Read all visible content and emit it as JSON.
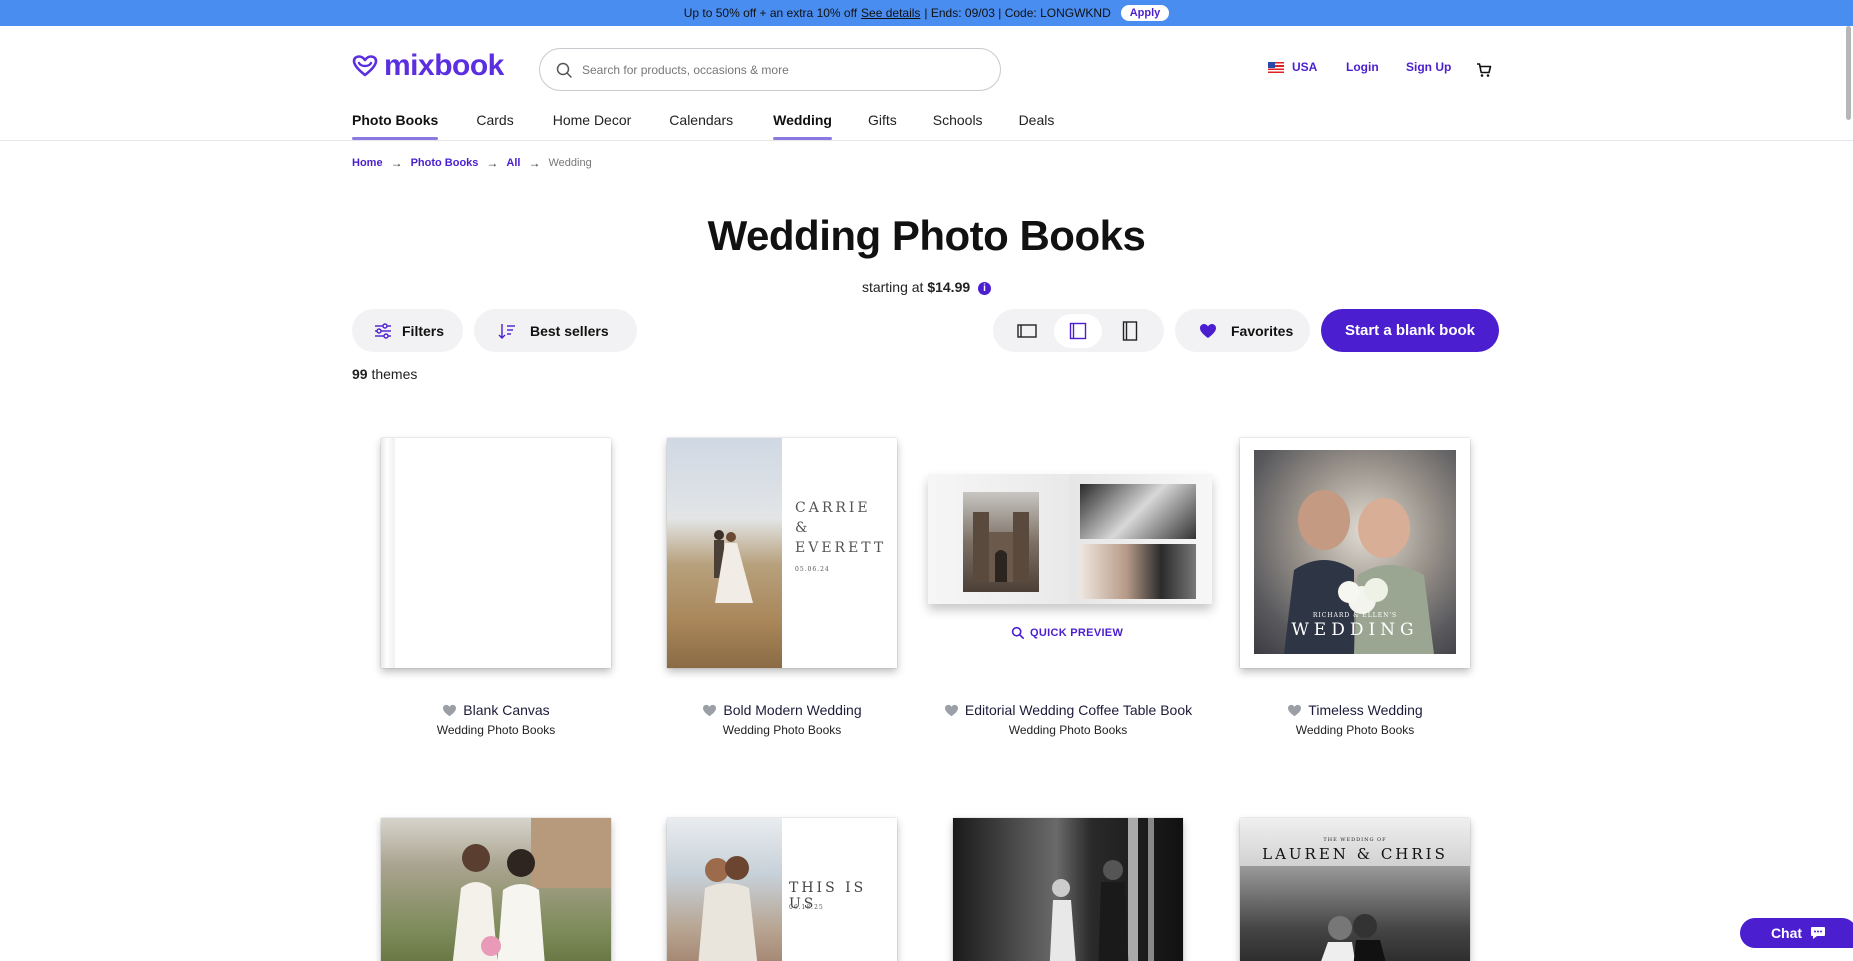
{
  "promo": {
    "text": "Up to 50% off + an extra 10% off",
    "link": "See details",
    "rest": "| Ends: 09/03 | Code: LONGWKND",
    "apply": "Apply"
  },
  "header": {
    "logo": "mixbook",
    "search_placeholder": "Search for products, occasions & more",
    "country": "USA",
    "login": "Login",
    "signup": "Sign Up"
  },
  "nav": [
    {
      "label": "Photo Books",
      "active": true
    },
    {
      "label": "Cards",
      "active": false
    },
    {
      "label": "Home Decor",
      "active": false
    },
    {
      "label": "Calendars",
      "active": false
    },
    {
      "label": "Wedding",
      "active": true
    },
    {
      "label": "Gifts",
      "active": false
    },
    {
      "label": "Schools",
      "active": false
    },
    {
      "label": "Deals",
      "active": false
    }
  ],
  "breadcrumb": [
    "Home",
    "Photo Books",
    "All",
    "Wedding"
  ],
  "page": {
    "title": "Wedding Photo Books",
    "starting_prefix": "starting at",
    "starting_price": "$14.99",
    "info": "i"
  },
  "toolbar": {
    "filters": "Filters",
    "sort": "Best sellers",
    "favorites": "Favorites",
    "cta": "Start a blank book"
  },
  "results": {
    "count": "99",
    "label": "themes"
  },
  "products": [
    {
      "title": "Blank Canvas",
      "subtitle": "Wedding Photo Books"
    },
    {
      "title": "Bold Modern Wedding",
      "subtitle": "Wedding Photo Books",
      "cover_text": [
        "CARRIE",
        "&",
        "EVERETT"
      ],
      "cover_date": "05.06.24"
    },
    {
      "title": "Editorial Wedding Coffee Table Book",
      "subtitle": "Wedding Photo Books",
      "quick_preview": "QUICK PREVIEW"
    },
    {
      "title": "Timeless Wedding",
      "subtitle": "Wedding Photo Books",
      "cover_kicker": "RICHARD & ELLEN'S",
      "cover_text": "WEDDING"
    },
    {
      "title": "",
      "subtitle": ""
    },
    {
      "title": "",
      "subtitle": "",
      "cover_text": "THIS IS US",
      "cover_date": "06.18.25"
    },
    {
      "title": "",
      "subtitle": ""
    },
    {
      "title": "",
      "subtitle": "",
      "cover_kicker": "THE WEDDING OF",
      "cover_text": "LAUREN & CHRIS"
    }
  ],
  "chat": {
    "label": "Chat"
  },
  "colors": {
    "brand": "#4b1fcf",
    "promo_bar": "#4a8df0",
    "nav_underline": "#8b78e0"
  }
}
